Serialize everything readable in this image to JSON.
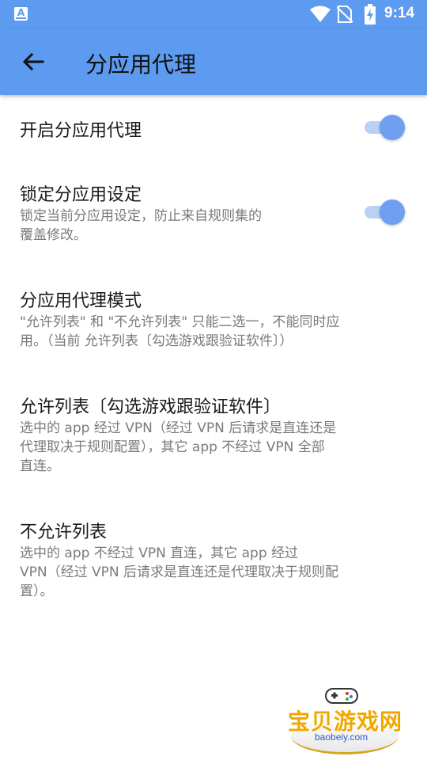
{
  "status_bar": {
    "time": "9:14",
    "icons": [
      "app-notification-icon",
      "wifi-icon",
      "no-sim-icon",
      "battery-charging-icon"
    ],
    "app_badge": "A"
  },
  "app_bar": {
    "title": "分应用代理",
    "back_icon": "arrow-back-icon"
  },
  "colors": {
    "primary": "#5c9bf0",
    "switch_thumb": "#6e9ff0",
    "switch_track": "#b9d1f4",
    "title_text": "#1a1a1a",
    "summary_text": "#7a7a7a"
  },
  "settings": [
    {
      "title": "开启分应用代理",
      "summary": "",
      "toggle": true
    },
    {
      "title": "锁定分应用设定",
      "summary_lines": [
        "锁定当前分应用设定，防止来自规则集的",
        "覆盖修改。"
      ],
      "toggle": true
    },
    {
      "title": "分应用代理模式",
      "summary_lines": [
        "\"允许列表\" 和 \"不允许列表\" 只能二选一，不能同时应",
        "用。（当前 允许列表〔勾选游戏跟验证软件〕）"
      ]
    },
    {
      "title": "允许列表〔勾选游戏跟验证软件〕",
      "summary_lines": [
        "选中的 app 经过 VPN（经过 VPN 后请求是直连还是",
        "代理取决于规则配置），其它 app 不经过 VPN 全部",
        "直连。"
      ]
    },
    {
      "title": "不允许列表",
      "summary_lines": [
        "选中的 app 不经过 VPN 直连，其它 app 经过",
        "VPN（经过 VPN 后请求是直连还是代理取决于规则配",
        "置）。"
      ]
    }
  ],
  "watermark": {
    "text": "宝贝游戏网",
    "url": "baobeiy.com"
  }
}
